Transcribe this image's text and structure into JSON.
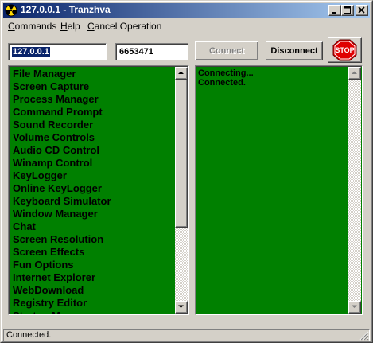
{
  "window": {
    "title": "127.0.0.1 - Tranzhva",
    "icon": "radiation-icon",
    "title_gradient": [
      "#0a246a",
      "#a6caf0"
    ]
  },
  "menu": {
    "items": [
      {
        "label": "Commands",
        "hotkey": "C"
      },
      {
        "label": "Help",
        "hotkey": "H"
      },
      {
        "label": "Cancel Operation",
        "hotkey": "C"
      }
    ]
  },
  "connection": {
    "host_value": "127.0.0.1",
    "port_value": "6653471",
    "connect_label": "Connect",
    "connect_enabled": false,
    "disconnect_label": "Disconnect",
    "stop_label": "STOP"
  },
  "features": {
    "background": "#008000",
    "items": [
      "File Manager",
      "Screen Capture",
      "Process Manager",
      "Command Prompt",
      "Sound Recorder",
      "Volume Controls",
      "Audio CD Control",
      "Winamp Control",
      "KeyLogger",
      "Online KeyLogger",
      "Keyboard Simulator",
      "Window Manager",
      "Chat",
      "Screen Resolution",
      "Screen Effects",
      "Fun Options",
      "Internet Explorer",
      "WebDownload",
      "Registry Editor",
      "Startup Manager"
    ]
  },
  "log": {
    "lines": [
      "Connecting...",
      "Connected."
    ]
  },
  "status": {
    "text": "Connected."
  }
}
